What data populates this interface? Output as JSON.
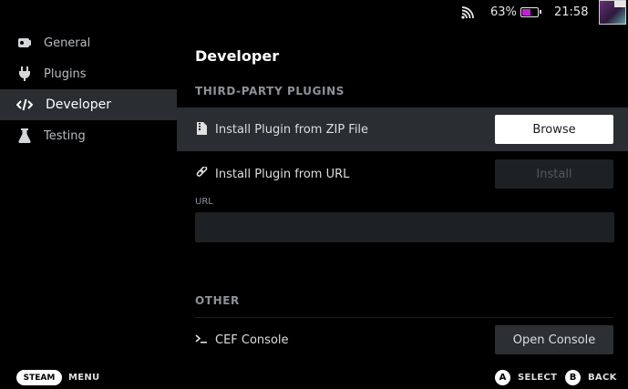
{
  "status": {
    "battery_percent": "63%",
    "battery_level": 0.63,
    "time": "21:58",
    "wifi_icon": "wifi-icon",
    "accent_color": "#c51fd6"
  },
  "sidebar": {
    "items": [
      {
        "label": "General",
        "icon": "gamepad-icon"
      },
      {
        "label": "Plugins",
        "icon": "plug-icon"
      },
      {
        "label": "Developer",
        "icon": "code-icon",
        "active": true
      },
      {
        "label": "Testing",
        "icon": "flask-icon"
      }
    ]
  },
  "main": {
    "title": "Developer",
    "section_third_party": "THIRD-PARTY PLUGINS",
    "zip_row": {
      "label": "Install Plugin from ZIP File",
      "button": "Browse"
    },
    "url_row": {
      "label": "Install Plugin from URL",
      "button": "Install"
    },
    "url_field": {
      "label": "URL",
      "value": "",
      "placeholder": ""
    },
    "section_other": "OTHER",
    "cef_row": {
      "label": "CEF Console",
      "button": "Open Console"
    }
  },
  "footer": {
    "steam": "STEAM",
    "menu": "MENU",
    "a_glyph": "A",
    "select": "SELECT",
    "b_glyph": "B",
    "back": "BACK"
  }
}
